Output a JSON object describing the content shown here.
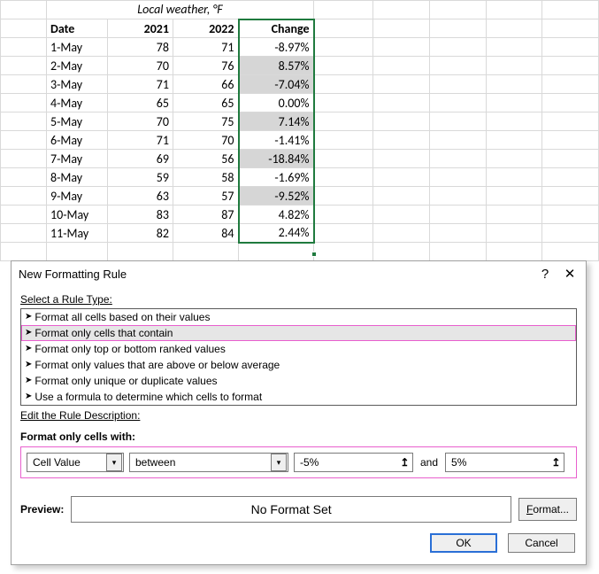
{
  "sheet": {
    "title": "Local weather, °F",
    "headers": {
      "date": "Date",
      "y2021": "2021",
      "y2022": "2022",
      "change": "Change"
    },
    "rows": [
      {
        "date": "1-May",
        "y2021": "78",
        "y2022": "71",
        "change": "-8.97%",
        "shade": false
      },
      {
        "date": "2-May",
        "y2021": "70",
        "y2022": "76",
        "change": "8.57%",
        "shade": true
      },
      {
        "date": "3-May",
        "y2021": "71",
        "y2022": "66",
        "change": "-7.04%",
        "shade": true
      },
      {
        "date": "4-May",
        "y2021": "65",
        "y2022": "65",
        "change": "0.00%",
        "shade": false
      },
      {
        "date": "5-May",
        "y2021": "70",
        "y2022": "75",
        "change": "7.14%",
        "shade": true
      },
      {
        "date": "6-May",
        "y2021": "71",
        "y2022": "70",
        "change": "-1.41%",
        "shade": false
      },
      {
        "date": "7-May",
        "y2021": "69",
        "y2022": "56",
        "change": "-18.84%",
        "shade": true
      },
      {
        "date": "8-May",
        "y2021": "59",
        "y2022": "58",
        "change": "-1.69%",
        "shade": false
      },
      {
        "date": "9-May",
        "y2021": "63",
        "y2022": "57",
        "change": "-9.52%",
        "shade": true
      },
      {
        "date": "10-May",
        "y2021": "83",
        "y2022": "87",
        "change": "4.82%",
        "shade": false
      },
      {
        "date": "11-May",
        "y2021": "82",
        "y2022": "84",
        "change": "2.44%",
        "shade": false
      }
    ]
  },
  "dialog": {
    "title": "New Formatting Rule",
    "help_glyph": "?",
    "close_glyph": "✕",
    "select_rule_label": "Select a Rule Type:",
    "rule_types": [
      "Format all cells based on their values",
      "Format only cells that contain",
      "Format only top or bottom ranked values",
      "Format only values that are above or below average",
      "Format only unique or duplicate values",
      "Use a formula to determine which cells to format"
    ],
    "selected_rule_index": 1,
    "edit_desc_label": "Edit the Rule Description:",
    "criteria_label": "Format only cells with:",
    "criteria": {
      "subject": "Cell Value",
      "operator": "between",
      "value1": "-5%",
      "and_label": "and",
      "value2": "5%",
      "chevron": "▾",
      "collapse": "↥"
    },
    "preview_label": "Preview:",
    "preview_text": "No Format Set",
    "format_btn_prefix": "F",
    "format_btn_rest": "ormat...",
    "ok_label": "OK",
    "cancel_label": "Cancel"
  }
}
